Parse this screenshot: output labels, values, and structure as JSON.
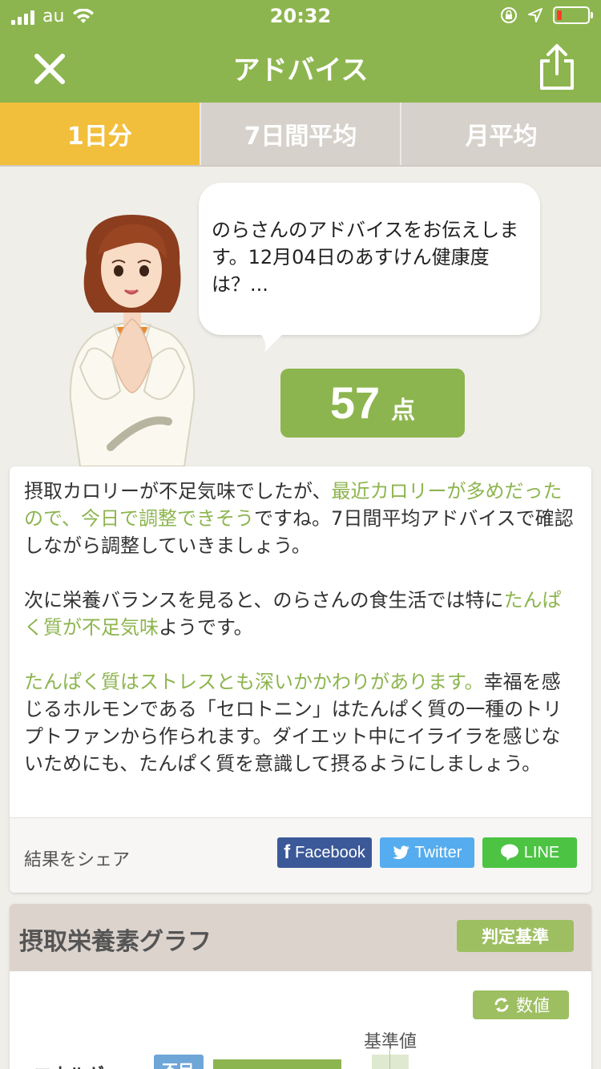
{
  "status": {
    "carrier": "au",
    "time": "20:32"
  },
  "nav": {
    "title": "アドバイス"
  },
  "tabs": [
    {
      "label": "1日分",
      "active": true
    },
    {
      "label": "7日間平均",
      "active": false
    },
    {
      "label": "月平均",
      "active": false
    }
  ],
  "advice": {
    "bubble_text": "のらさんのアドバイスをお伝えします。12月04日のあすけん健康度は？...",
    "score": "57",
    "score_unit": "点",
    "p1_a": "摂取カロリーが不足気味でしたが、",
    "p1_hl": "最近カロリーが多めだったので、今日で調整できそう",
    "p1_b": "ですね。7日間平均アドバイスで確認しながら調整していきましょう。",
    "p2_a": "次に栄養バランスを見ると、のらさんの食生活では特に",
    "p2_hl": "たんぱく質が不足気味",
    "p2_b": "ようです。",
    "p3_hl": "たんぱく質はストレスとも深いかかわりがあります。",
    "p3_b": "幸福を感じるホルモンである「セロトニン」はたんぱく質の一種のトリプトファンから作られます。ダイエット中にイライラを感じないためにも、たんぱく質を意識して摂るようにしましょう。"
  },
  "share": {
    "label": "結果をシェア",
    "facebook": "Facebook",
    "twitter": "Twitter",
    "line": "LINE"
  },
  "graph": {
    "title": "摂取栄養素グラフ",
    "criteria_button": "判定基準",
    "values_button": "数値",
    "base_label": "基準値",
    "row_label": "エネルギー",
    "short_badge": "不足"
  },
  "colors": {
    "accent_green": "#8db54f",
    "tab_active": "#f2bf3c",
    "facebook": "#3b5998",
    "twitter": "#55acee",
    "line": "#4cc343"
  }
}
